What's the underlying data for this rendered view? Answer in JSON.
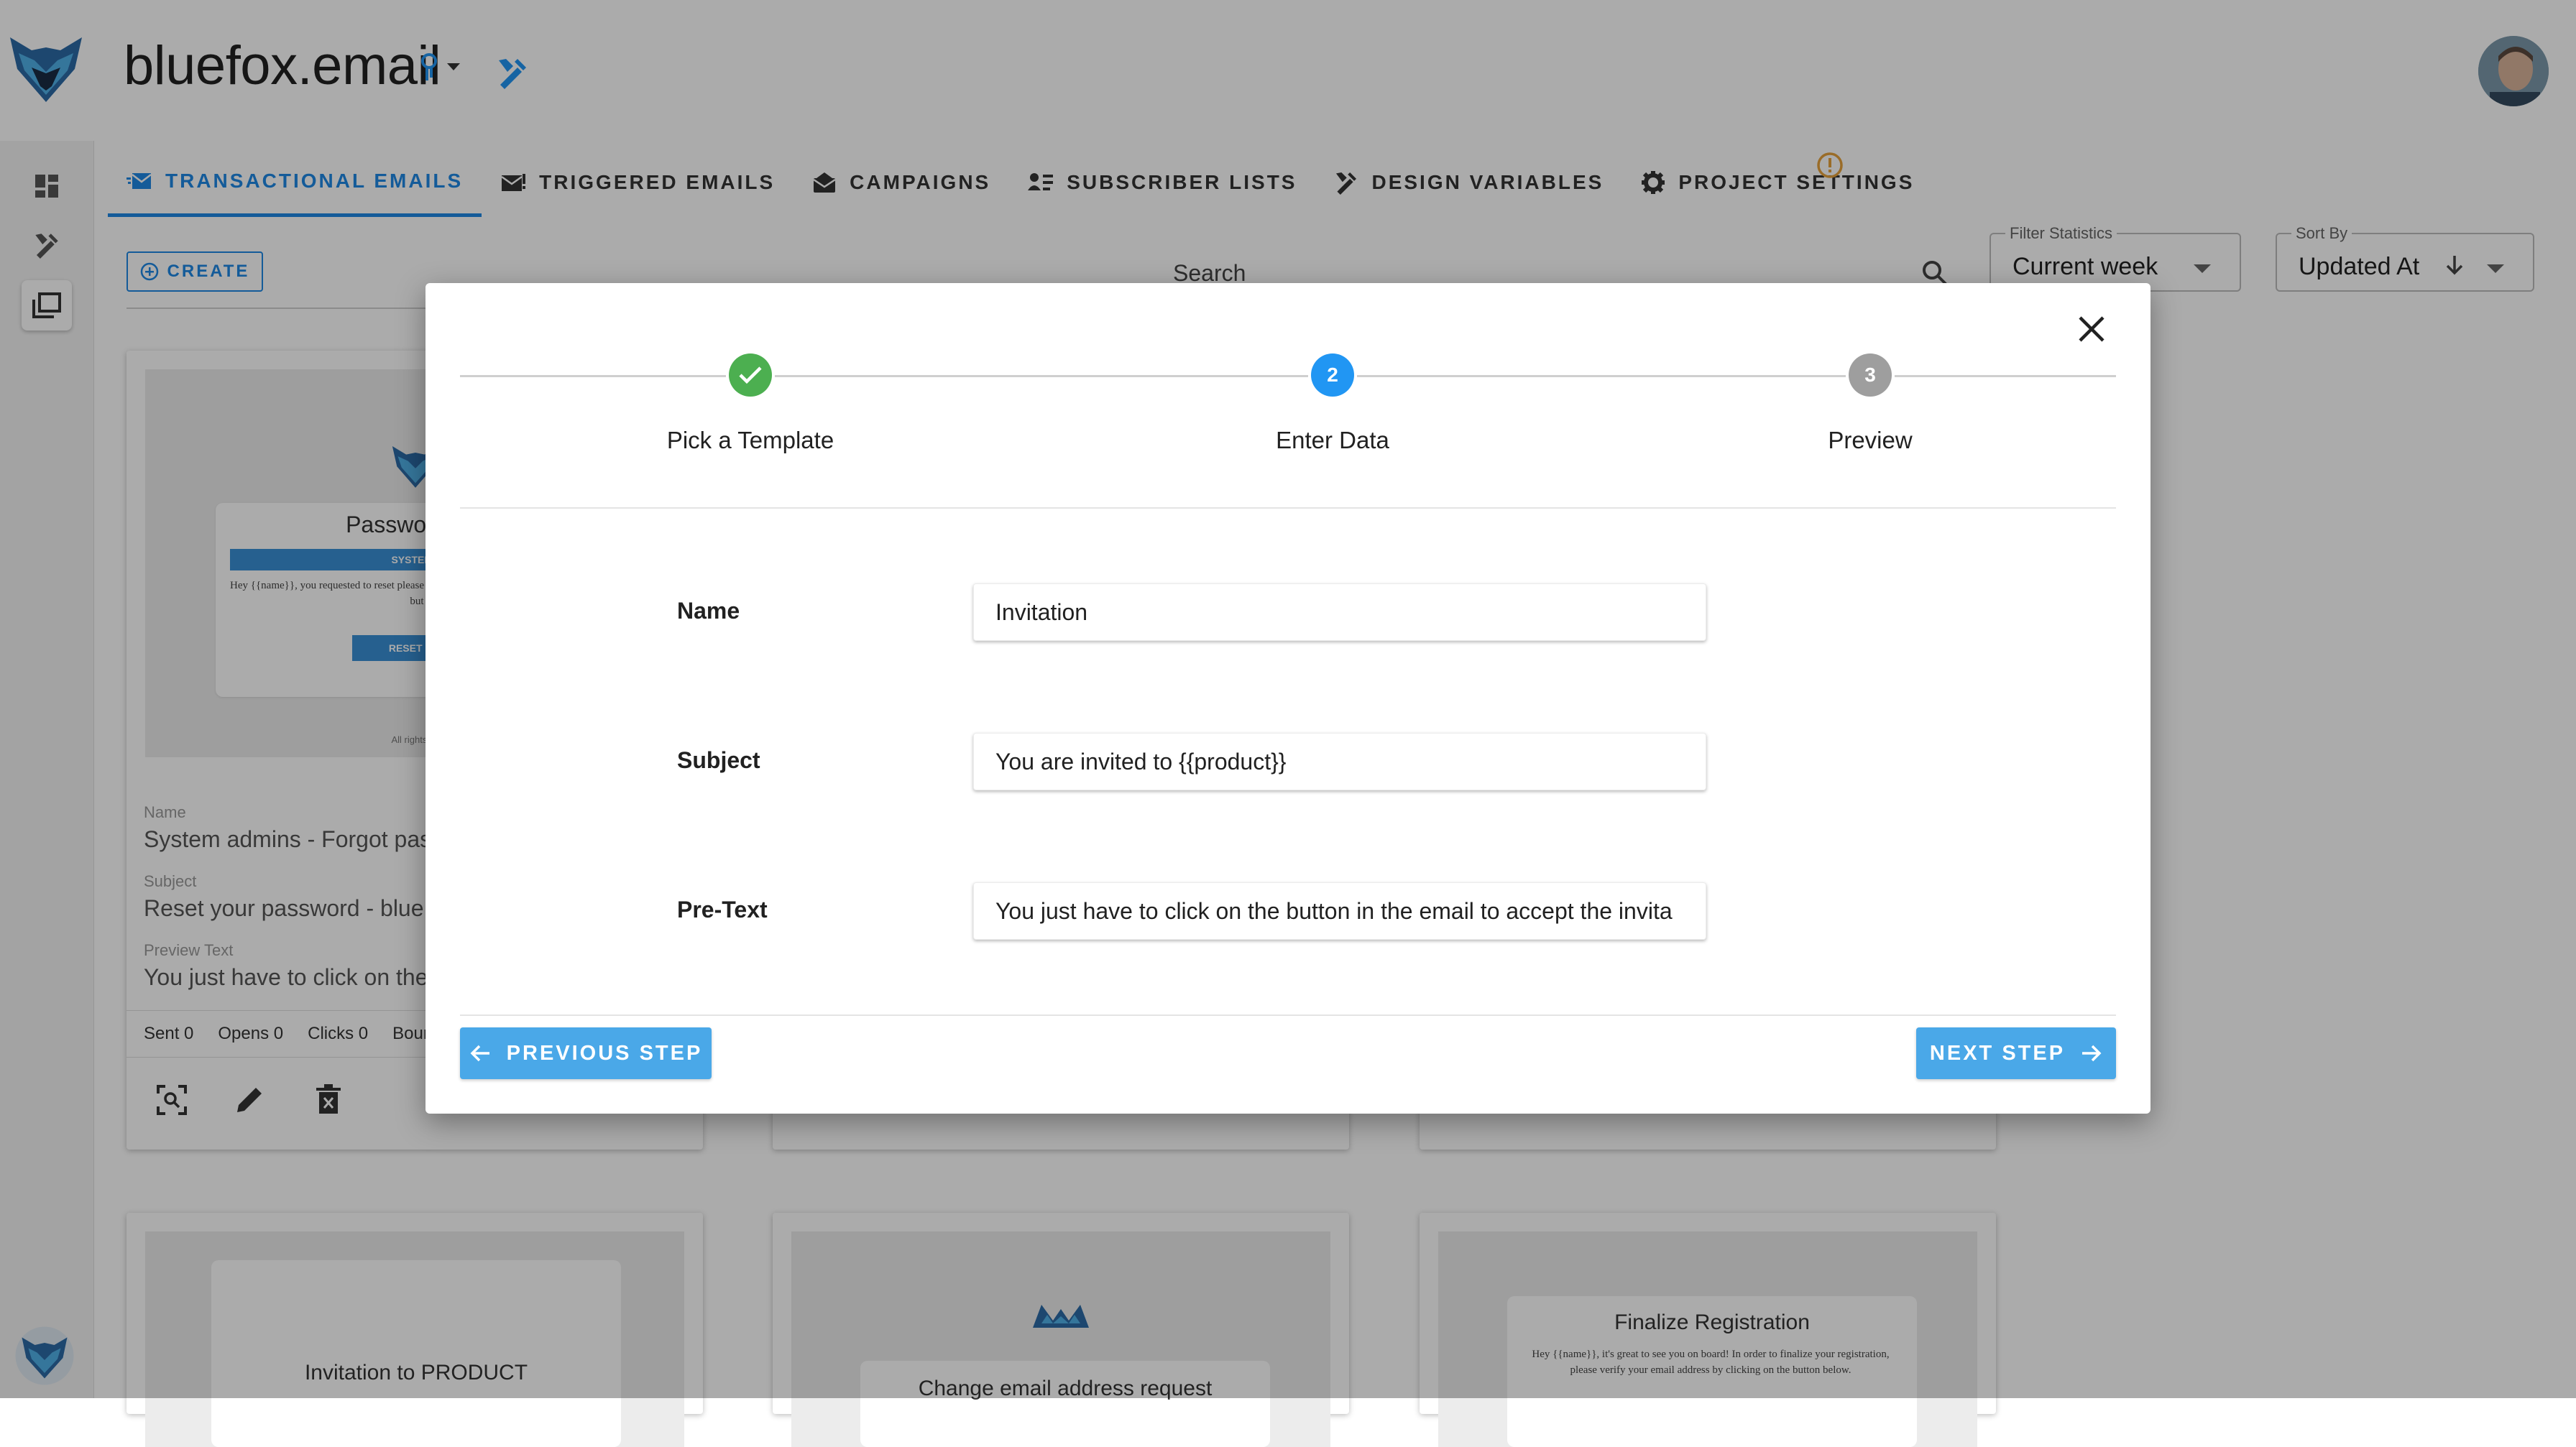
{
  "app": {
    "title": "bluefox.email",
    "avatar_alt": "user avatar"
  },
  "tabs": [
    {
      "label": "TRANSACTIONAL EMAILS",
      "icon": "transactional-email-icon",
      "active": true
    },
    {
      "label": "TRIGGERED EMAILS",
      "icon": "triggered-email-icon",
      "active": false
    },
    {
      "label": "CAMPAIGNS",
      "icon": "campaign-icon",
      "active": false
    },
    {
      "label": "SUBSCRIBER LISTS",
      "icon": "subscriber-list-icon",
      "active": false
    },
    {
      "label": "DESIGN VARIABLES",
      "icon": "design-tools-icon",
      "active": false
    },
    {
      "label": "PROJECT SETTINGS",
      "icon": "gear-icon",
      "active": false
    }
  ],
  "toolbar": {
    "create_label": "CREATE",
    "search_label": "Search",
    "filter": {
      "legend": "Filter Statistics",
      "value": "Current week"
    },
    "sort": {
      "legend": "Sort By",
      "value": "Updated At"
    }
  },
  "cards": {
    "first": {
      "preview_title": "Password res",
      "preview_banner": "SYSTEM A",
      "preview_text": "Hey {{name}}, you requested to reset please ignore this email, if you wan click on the but",
      "preview_button": "RESET PAS",
      "preview_footer": "All rights re",
      "name_label": "Name",
      "name_value": "System admins - Forgot pas",
      "subject_label": "Subject",
      "subject_value": "Reset your password - blue",
      "preview_label": "Preview Text",
      "preview_value": "You just have to click on the",
      "stats": {
        "sent": "Sent 0",
        "opens": "Opens 0",
        "clicks": "Clicks 0",
        "bounces": "Boun"
      }
    },
    "bottom": [
      {
        "title": "Invitation to PRODUCT"
      },
      {
        "title": "Change email address request"
      },
      {
        "title": "Finalize Registration",
        "text": "Hey {{name}}, it's great to see you on board! In order to finalize your registration, please verify your email address by clicking on the button below."
      }
    ]
  },
  "dialog": {
    "steps": [
      {
        "number": "1",
        "label": "Pick a Template",
        "state": "done"
      },
      {
        "number": "2",
        "label": "Enter Data",
        "state": "active"
      },
      {
        "number": "3",
        "label": "Preview",
        "state": "pending"
      }
    ],
    "fields": {
      "name": {
        "label": "Name",
        "value": "Invitation"
      },
      "subject": {
        "label": "Subject",
        "value": "You are invited to {{product}}"
      },
      "pretext": {
        "label": "Pre-Text",
        "value": "You just have to click on the button in the email to accept the invita"
      }
    },
    "prev_label": "PREVIOUS STEP",
    "next_label": "NEXT STEP"
  },
  "colors": {
    "accent": "#1e88e5",
    "step_done": "#4caf50",
    "step_active": "#2196f3",
    "step_pending": "#9e9e9e",
    "button": "#4aa8e8",
    "warning": "#e6a23c"
  }
}
